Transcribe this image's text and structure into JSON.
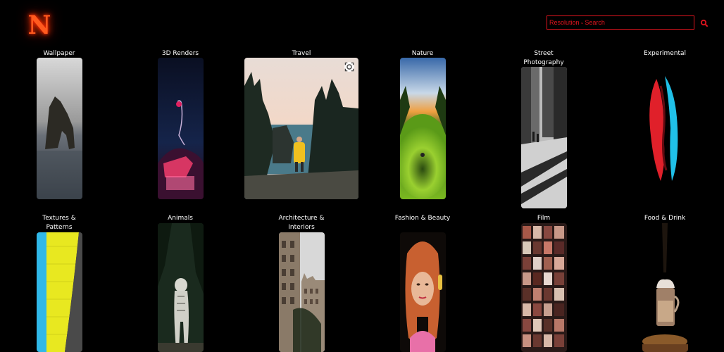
{
  "header": {
    "logo_letter": "N",
    "resolution_label": "Resolution",
    "search_placeholder": "Search"
  },
  "categories": [
    {
      "label": "Wallpaper"
    },
    {
      "label": "3D Renders"
    },
    {
      "label": "Travel"
    },
    {
      "label": "Nature"
    },
    {
      "label": "Street Photography"
    },
    {
      "label": "Experimental"
    },
    {
      "label": "Textures & Patterns"
    },
    {
      "label": "Animals"
    },
    {
      "label": "Architecture & Interiors"
    },
    {
      "label": "Fashion & Beauty"
    },
    {
      "label": "Film"
    },
    {
      "label": "Food & Drink"
    }
  ],
  "colors": {
    "accent": "#e0141e",
    "background": "#000000",
    "text": "#ffffff"
  }
}
